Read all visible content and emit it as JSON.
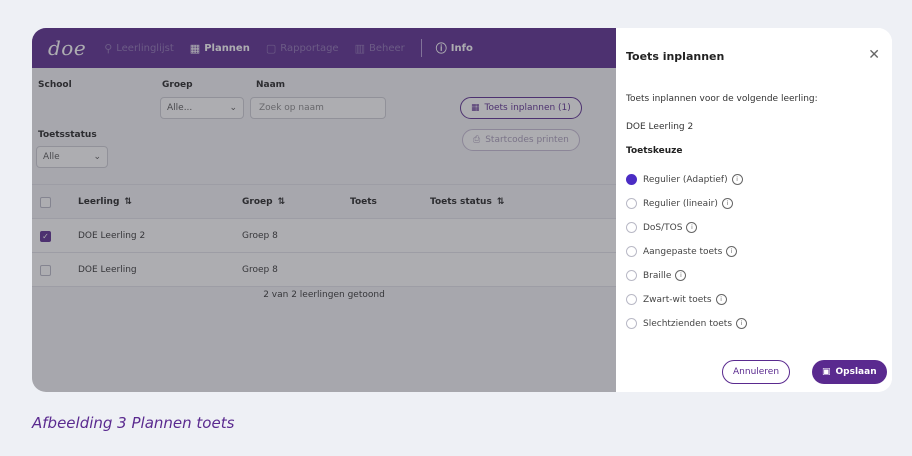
{
  "nav": {
    "logo": "doe",
    "items": [
      {
        "icon": "⚲",
        "label": "Leerlinglijst"
      },
      {
        "icon": "▦",
        "label": "Plannen"
      },
      {
        "icon": "▢",
        "label": "Rapportage"
      },
      {
        "icon": "▥",
        "label": "Beheer"
      },
      {
        "icon": "ⓘ",
        "label": "Info"
      }
    ]
  },
  "filters": {
    "school_label": "School",
    "groep_label": "Groep",
    "groep_value": "Alle...",
    "naam_label": "Naam",
    "naam_placeholder": "Zoek op naam",
    "toetsstatus_label": "Toetsstatus",
    "toetsstatus_value": "Alle"
  },
  "actions": {
    "toets_inplannen": "Toets inplannen (1)",
    "startcodes": "Startcodes printen"
  },
  "table": {
    "headers": [
      "Leerling",
      "Groep",
      "Toets",
      "Toets status"
    ],
    "rows": [
      {
        "checked": true,
        "leerling": "DOE Leerling 2",
        "groep": "Groep 8"
      },
      {
        "checked": false,
        "leerling": "DOE Leerling",
        "groep": "Groep 8"
      }
    ],
    "footer": "2 van 2 leerlingen getoond"
  },
  "panel": {
    "title": "Toets inplannen",
    "intro": "Toets inplannen voor de volgende leerling:",
    "student": "DOE Leerling 2",
    "section": "Toetskeuze",
    "options": [
      "Regulier (Adaptief)",
      "Regulier (lineair)",
      "DoS/TOS",
      "Aangepaste toets",
      "Braille",
      "Zwart-wit toets",
      "Slechtzienden toets"
    ],
    "selected_index": 0,
    "cancel": "Annuleren",
    "save": "Opslaan"
  },
  "caption": "Afbeelding 3 Plannen toets",
  "colors": {
    "accent": "#5a2a8f",
    "radio_selected": "#4b2cc4"
  }
}
